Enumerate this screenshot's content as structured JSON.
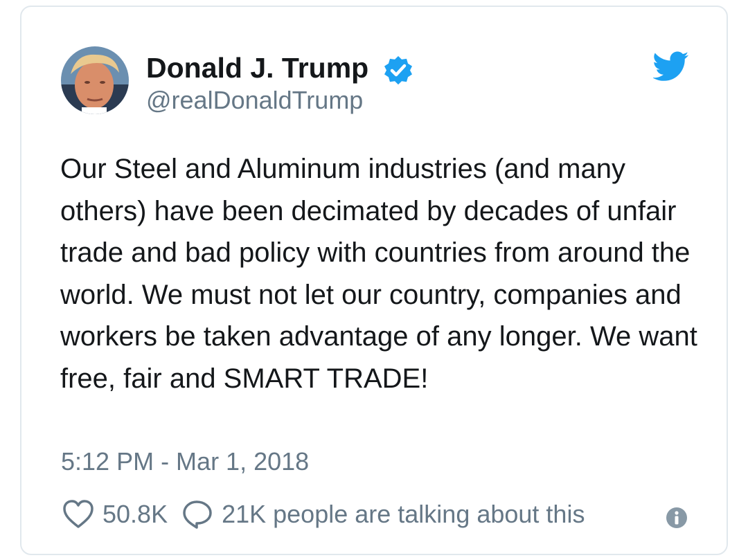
{
  "tweet": {
    "author": {
      "display_name": "Donald J. Trump",
      "handle": "@realDonaldTrump",
      "verified": true,
      "avatar_icon": "profile-photo"
    },
    "text": "Our Steel and Aluminum industries (and many others) have been decimated by decades of unfair trade and bad policy with countries from around the world. We must not let our country, companies and workers be taken advantage of any longer. We want free, fair and SMART TRADE!",
    "timestamp": "5:12 PM - Mar 1, 2018",
    "likes": "50.8K",
    "talking_about": "21K people are talking about this"
  },
  "icons": {
    "brand": "twitter-bird-icon",
    "verified": "verified-badge-icon",
    "like": "heart-icon",
    "reply": "speech-bubble-icon",
    "info": "info-icon"
  },
  "colors": {
    "brand_blue": "#1da1f2",
    "text_primary": "#14171a",
    "text_secondary": "#657786",
    "border": "#e1e8ed"
  }
}
